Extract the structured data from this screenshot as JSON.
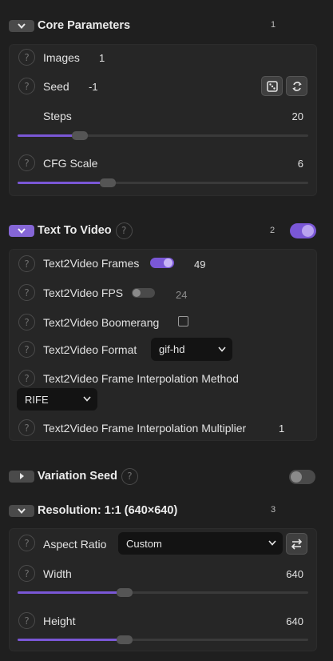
{
  "core": {
    "title": "Core Parameters",
    "number": "1",
    "images": {
      "label": "Images",
      "value": "1"
    },
    "seed": {
      "label": "Seed",
      "value": "-1"
    },
    "steps": {
      "label": "Steps",
      "value": "20",
      "fraction": 0.24
    },
    "cfg": {
      "label": "CFG Scale",
      "value": "6",
      "fraction": 0.3
    }
  },
  "t2v": {
    "title": "Text To Video",
    "number": "2",
    "enabled": true,
    "frames": {
      "label": "Text2Video Frames",
      "value": "49",
      "toggle_on": true
    },
    "fps": {
      "label": "Text2Video FPS",
      "value": "24",
      "toggle_on": false
    },
    "boomerang": {
      "label": "Text2Video Boomerang",
      "checked": false
    },
    "format": {
      "label": "Text2Video Format",
      "value": "gif-hd"
    },
    "interp_method": {
      "label": "Text2Video Frame Interpolation Method",
      "value": "RIFE"
    },
    "interp_mult": {
      "label": "Text2Video Frame Interpolation Multiplier",
      "value": "1"
    }
  },
  "variation": {
    "title": "Variation Seed",
    "enabled": false
  },
  "resolution": {
    "title": "Resolution: 1:1 (640×640)",
    "number": "3",
    "aspect": {
      "label": "Aspect Ratio",
      "value": "Custom"
    },
    "width": {
      "label": "Width",
      "value": "640",
      "fraction": 0.37
    },
    "height": {
      "label": "Height",
      "value": "640",
      "fraction": 0.37
    }
  },
  "help_glyph": "?",
  "icons": {
    "collapse": "chevron-down-icon",
    "expand": "chevron-right-icon",
    "help": "help-icon",
    "dice": "dice-icon",
    "reuse": "recycle-icon",
    "swap": "swap-icon",
    "dropdown": "chevron-down-icon"
  },
  "colors": {
    "accent": "#7a57d6",
    "panel": "#262626",
    "background": "#1f1f1f",
    "input": "#131313"
  }
}
